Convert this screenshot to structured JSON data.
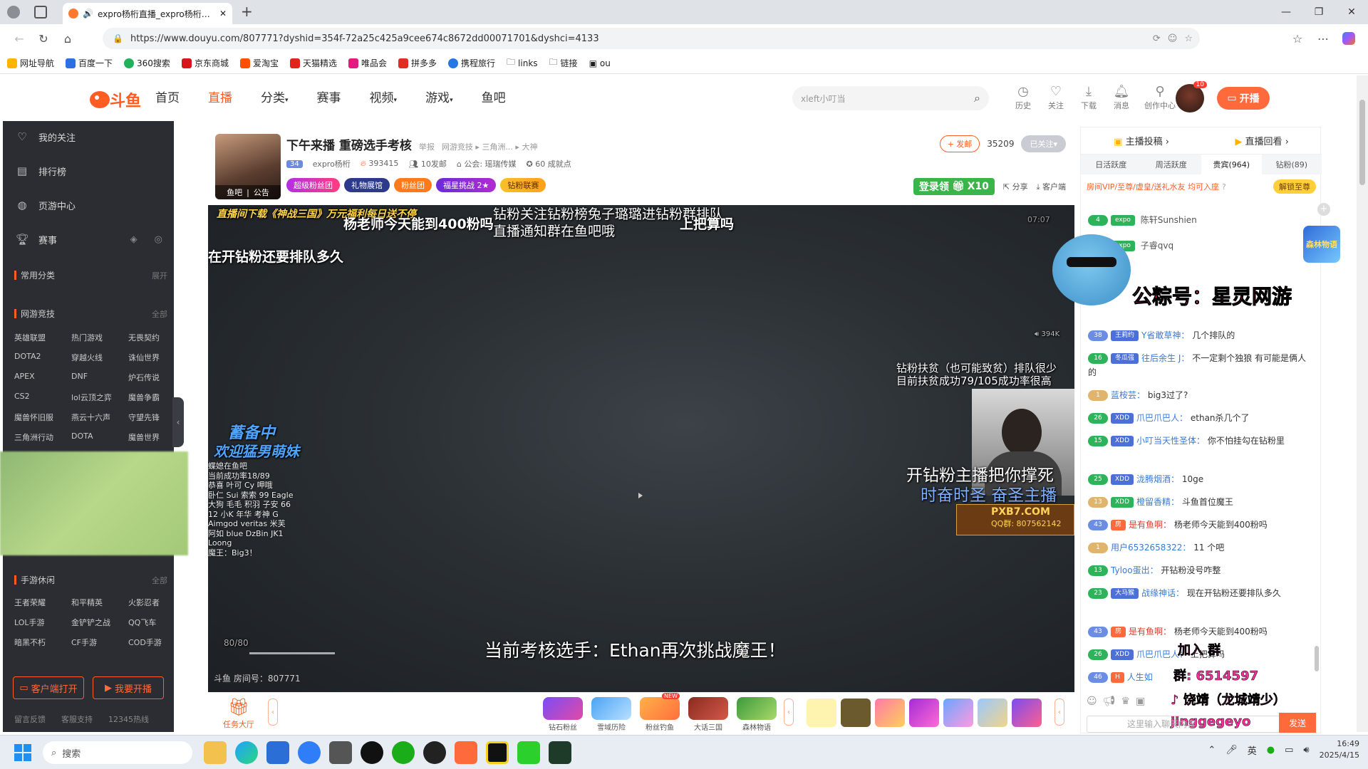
{
  "browser": {
    "tab_title": "expro杨桁直播_expro杨桁直...",
    "url": "https://www.douyu.com/807771?dyshid=354f-72a25c425a9cee674c8672dd00071701&dyshci=4133",
    "bookmarks": [
      "网址导航",
      "百度一下",
      "360搜索",
      "京东商城",
      "爱淘宝",
      "天猫精选",
      "唯品会",
      "拼多多",
      "携程旅行",
      "links",
      "链接",
      "ou"
    ]
  },
  "header": {
    "logo_text": "斗鱼",
    "nav": [
      "首页",
      "直播",
      "分类",
      "赛事",
      "视频",
      "游戏",
      "鱼吧"
    ],
    "search_placeholder": "xleft小叮当",
    "tools": [
      "历史",
      "关注",
      "下载",
      "消息",
      "创作中心"
    ],
    "avatar_badge": "10",
    "start_live": "开播"
  },
  "sidebar": {
    "items": [
      "我的关注",
      "排行榜",
      "页游中心",
      "赛事"
    ],
    "common_title": "常用分类",
    "common_more": "展开",
    "esports_title": "网游竞技",
    "esports_more": "全部",
    "esports": [
      "英雄联盟",
      "热门游戏",
      "无畏契约",
      "DOTA2",
      "穿越火线",
      "诛仙世界",
      "APEX",
      "DNF",
      "炉石传说",
      "CS2",
      "lol云顶之弈",
      "魔兽争霸",
      "魔兽怀旧服",
      "燕云十六声",
      "守望先锋",
      "三角洲行动",
      "DOTA",
      "魔兽世界"
    ],
    "mobile_title": "手游休闲",
    "mobile_more": "全部",
    "mobile": [
      "王者荣耀",
      "和平精英",
      "火影忍者",
      "LOL手游",
      "金铲铲之战",
      "QQ飞车",
      "暗黑不朽",
      "CF手游",
      "COD手游"
    ],
    "btn_client": "客户端打开",
    "btn_live": "我要开播",
    "footer": [
      "留言反馈",
      "客服支持",
      "12345热线"
    ]
  },
  "room": {
    "thumb_labels": [
      "鱼吧",
      "公告"
    ],
    "title": "下午来播 重磅选手考核",
    "report": "举报",
    "breadcrumb": [
      "网游竞技",
      "三角洲...",
      "大神"
    ],
    "level": "34",
    "anchor": "expro杨桁",
    "hot": "393415",
    "friends": "10发邮",
    "guild": "公会: 瑶瑞传媒",
    "score": "60 成就点",
    "badges": [
      "超级粉丝团",
      "礼物展馆",
      "粉丝团",
      "福星挑战 2★",
      "钻粉联赛"
    ],
    "send_fy": "+ 发邮",
    "fans_count": "35209",
    "followed": "已关注",
    "login_gift": "登录领",
    "login_gift_count": "X10",
    "share": "分享",
    "client": "客户端"
  },
  "video": {
    "overlays": [
      "直播间下载《神战三国》万元福利每日送不停",
      "钻粉关注钻粉榜兔子璐璐进钻粉群排队",
      "直播通知群在鱼吧哦",
      "杨老师今天能到400粉吗",
      "上把算吗",
      "在开钻粉还要排队多久",
      "钻粉扶贫（也可能致贫）排队很少",
      "目前扶贫成功79/105成功率很高",
      "开钻粉主播把你撑死",
      "时奋时圣 奋圣主播",
      "当前考核选手：Ethan再次挑战魔王！",
      "蓄备中",
      "欢迎猛男萌妹"
    ],
    "top_right_label": "07:07",
    "volume_label": "394K",
    "left_list": [
      "蝶媳在鱼吧",
      "当前成功率18/89",
      "恭喜 叶可 Cy 呷哦",
      "卧仁 Sui 索索 99 Eagle",
      "大狗 毛毛 积羽 子安 66",
      "12 小K 年华 考神 G",
      "Aimgod veritas 米芙",
      "阿如 blue DzBin JK1",
      "Loong",
      "魔王：Big3！"
    ],
    "pxb_text": "PXB7.COM",
    "pxb_sub": "QQ群: 807562142",
    "player_hp": "80/80",
    "room_number": "斗鱼 房间号：807771"
  },
  "bottom_bar": {
    "task": "任务大厅",
    "icons": [
      "钻石粉丝",
      "雪域历险",
      "粉丝钓鱼",
      "大话三国",
      "森林物语"
    ],
    "new_badge": "NEW"
  },
  "chat": {
    "top": [
      "主播投稿",
      "直播回看"
    ],
    "tabs": [
      "日活跃度",
      "周活跃度",
      "贵宾(964)",
      "钻粉(89)"
    ],
    "vip_text": "房间VIP/至尊/虚皇/送礼水友 均可入座",
    "vip_unlock": "解锁至尊",
    "messages": [
      {
        "lv": "4",
        "tag": "expo",
        "name": "陈轩Sunshien",
        "text": ""
      },
      {
        "lv": "",
        "tag": "expo",
        "name": "子睿qvq",
        "text": ""
      },
      {
        "lv": "38",
        "tag": "王莉约",
        "name": "Y省敢草神：",
        "text": "几个排队的"
      },
      {
        "lv": "16",
        "tag": "冬瓜强",
        "name": "往后余生 J：",
        "text": "不一定剩个独狼 有可能是俩人的"
      },
      {
        "lv": "1",
        "tag": "",
        "name": "蓝桉芸：",
        "text": "big3过了?"
      },
      {
        "lv": "26",
        "tag": "XDD",
        "name": "爪巴爪巴人：",
        "text": "ethan杀几个了"
      },
      {
        "lv": "15",
        "tag": "XDD",
        "name": "小叮当天性圣体：",
        "text": "你不怕挂勾在钻粉里"
      },
      {
        "lv": "25",
        "tag": "XDD",
        "name": "泷腾烟酒：",
        "text": "10ge"
      },
      {
        "lv": "13",
        "tag": "XDD",
        "name": "橙留香精：",
        "text": "斗鱼首位魔王"
      },
      {
        "lv": "43",
        "tag": "房",
        "name": "是有鱼啊：",
        "text": "杨老师今天能到400粉吗"
      },
      {
        "lv": "1",
        "tag": "",
        "name": "用户6532658322：",
        "text": "11 个吧"
      },
      {
        "lv": "13",
        "tag": "",
        "name": "Tyloo蛋出：",
        "text": "开钻粉没号咋整"
      },
      {
        "lv": "23",
        "tag": "大马猴",
        "name": "战缘神话：",
        "text": "现在开钻粉还要排队多久"
      },
      {
        "lv": "43",
        "tag": "房",
        "name": "是有鱼啊：",
        "text": "杨老师今天能到400粉吗"
      },
      {
        "lv": "26",
        "tag": "XDD",
        "name": "爪巴爪巴人：",
        "text": "上把算吗"
      },
      {
        "lv": "46",
        "tag": "H",
        "name": "人生如",
        "text": ""
      }
    ],
    "watermarks": {
      "wechat": "公粽号：星灵网游",
      "join_group": "加入",
      "group_suffix": "群",
      "qq_group": "群: 6514597",
      "douyin": "饶靖（龙城靖少）",
      "kuaishou": "jinggegeyo",
      "game_badge": "森林物语"
    },
    "input_placeholder": "这里输入聊天内容",
    "send": "发送"
  },
  "taskbar": {
    "search": "搜索",
    "ime": "英",
    "time": "16:49",
    "date": "2025/4/15"
  },
  "colors": {
    "brand": "#ff5d23",
    "sidebar_bg": "#2b2d33",
    "video_bg": "#2a2f33"
  }
}
